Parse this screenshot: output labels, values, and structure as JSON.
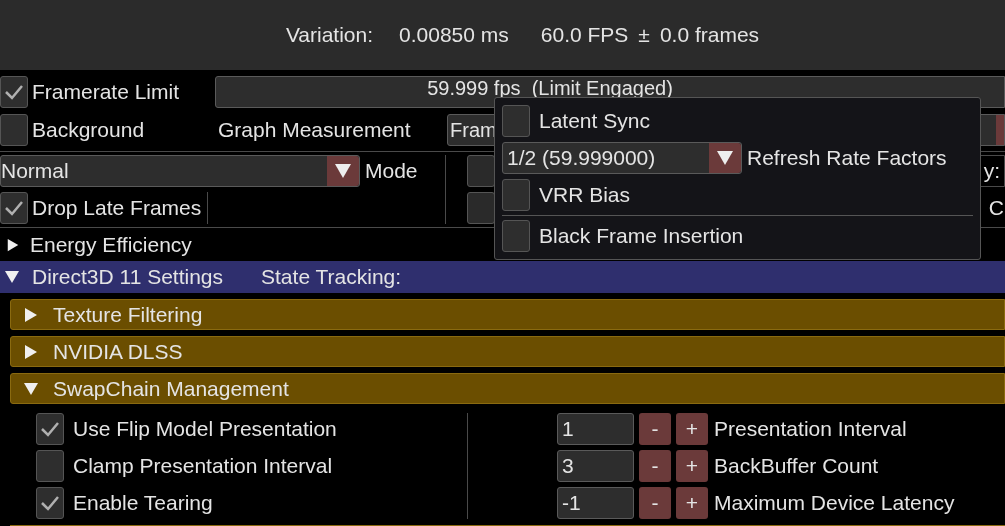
{
  "header_stats": [
    "Variation:",
    "0.00850 ms",
    "60.0 FPS",
    "±",
    "0.0 frames"
  ],
  "framerate_limit": {
    "label": "Framerate Limit",
    "checked": true,
    "value": "59.999 fps  (Limit Engaged)"
  },
  "background": {
    "label": "Background",
    "checked": false
  },
  "graph_measurement": {
    "label": "Graph Measurement",
    "value": "Fram"
  },
  "mode": {
    "label": "Mode",
    "value": "Normal"
  },
  "drop_late_frames": {
    "label": "Drop Late Frames",
    "checked": true
  },
  "sleepless_render": {
    "checked": false
  },
  "render_priority": {
    "label": "y:"
  },
  "sleepless_window": {
    "checked": false
  },
  "spoof_cpu": {
    "label": "C"
  },
  "energy_efficiency": {
    "label": "Energy Efficiency",
    "expanded": false
  },
  "d3d11": {
    "label": "Direct3D 11 Settings",
    "expanded": true,
    "state_tracking": "State Tracking:",
    "children": [
      {
        "label": "Texture Filtering",
        "expanded": false
      },
      {
        "label": "NVIDIA DLSS",
        "expanded": false
      },
      {
        "label": "SwapChain Management",
        "expanded": true,
        "rows": [
          {
            "check_label": "Use Flip Model Presentation",
            "checked": true,
            "value": "1",
            "minus": "-",
            "plus": "+",
            "setting": "Presentation Interval"
          },
          {
            "check_label": "Clamp Presentation Interval",
            "checked": false,
            "value": "3",
            "minus": "-",
            "plus": "+",
            "setting": "BackBuffer Count"
          },
          {
            "check_label": "Enable Tearing",
            "checked": true,
            "value": "-1",
            "minus": "-",
            "plus": "+",
            "setting": "Maximum Device Latency"
          }
        ]
      }
    ]
  },
  "popup": {
    "latent_sync": {
      "label": "Latent Sync",
      "checked": false
    },
    "refresh_rate_factors": {
      "label": "Refresh Rate Factors",
      "value": "1/2 (59.999000)"
    },
    "vrr_bias": {
      "label": "VRR Bias",
      "checked": false
    },
    "black_frame_insertion": {
      "label": "Black Frame Insertion",
      "checked": false
    }
  }
}
